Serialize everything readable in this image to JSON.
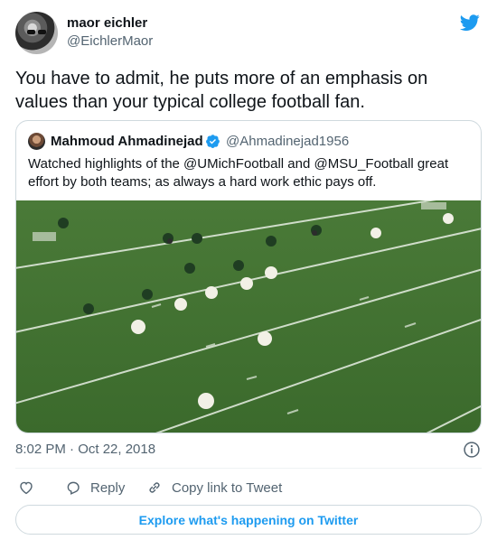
{
  "author": {
    "name": "maor eichler",
    "handle": "@EichlerMaor"
  },
  "tweet": {
    "text": "You have to admit, he puts more of an emphasis on values than your typical college football fan."
  },
  "quoted": {
    "author": {
      "name": "Mahmoud Ahmadinejad",
      "handle": "@Ahmadinejad1956",
      "verified": true
    },
    "text": "Watched highlights of the @UMichFootball  and @MSU_Football  great effort by both teams; as always a hard work ethic pays off."
  },
  "meta": {
    "timestamp": "8:02 PM · Oct 22, 2018"
  },
  "actions": {
    "reply_label": "Reply",
    "copy_label": "Copy link to Tweet"
  },
  "explore": {
    "label": "Explore what's happening on Twitter"
  },
  "icons": [
    "twitter-logo-icon",
    "verified-badge-icon",
    "info-icon",
    "heart-icon",
    "reply-icon",
    "link-icon"
  ],
  "colors": {
    "accent": "#1d9bf0",
    "secondary_text": "#536471",
    "border": "#cfd9de",
    "field": "#3f6b2e"
  }
}
